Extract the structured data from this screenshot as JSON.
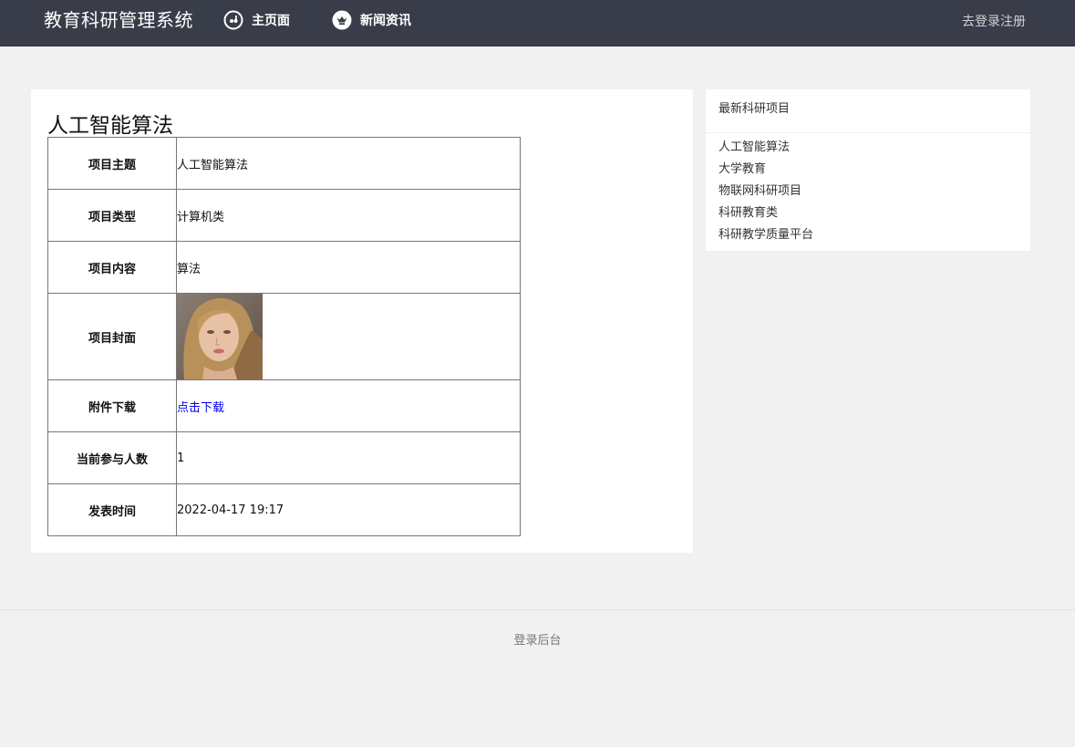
{
  "header": {
    "brand": "教育科研管理系统",
    "nav": [
      {
        "label": "主页面",
        "icon": "home-icon"
      },
      {
        "label": "新闻资讯",
        "icon": "crown-icon"
      }
    ],
    "login_register": "去登录注册",
    "bg_color": "#393d49"
  },
  "detail": {
    "title": "人工智能算法",
    "rows": [
      {
        "key": "项目主题",
        "value": "人工智能算法"
      },
      {
        "key": "项目类型",
        "value": "计算机类"
      },
      {
        "key": "项目内容",
        "value": "算法"
      },
      {
        "key": "项目封面",
        "value": ""
      },
      {
        "key": "附件下载",
        "value": "点击下载"
      },
      {
        "key": "当前参与人数",
        "value": "1"
      },
      {
        "key": "发表时间",
        "value": "2022-04-17 19:17"
      }
    ]
  },
  "sidebar": {
    "heading": "最新科研项目",
    "items": [
      "人工智能算法",
      "大学教育",
      "物联网科研项目",
      "科研教育类",
      "科研教学质量平台"
    ]
  },
  "footer": {
    "link": "登录后台"
  }
}
